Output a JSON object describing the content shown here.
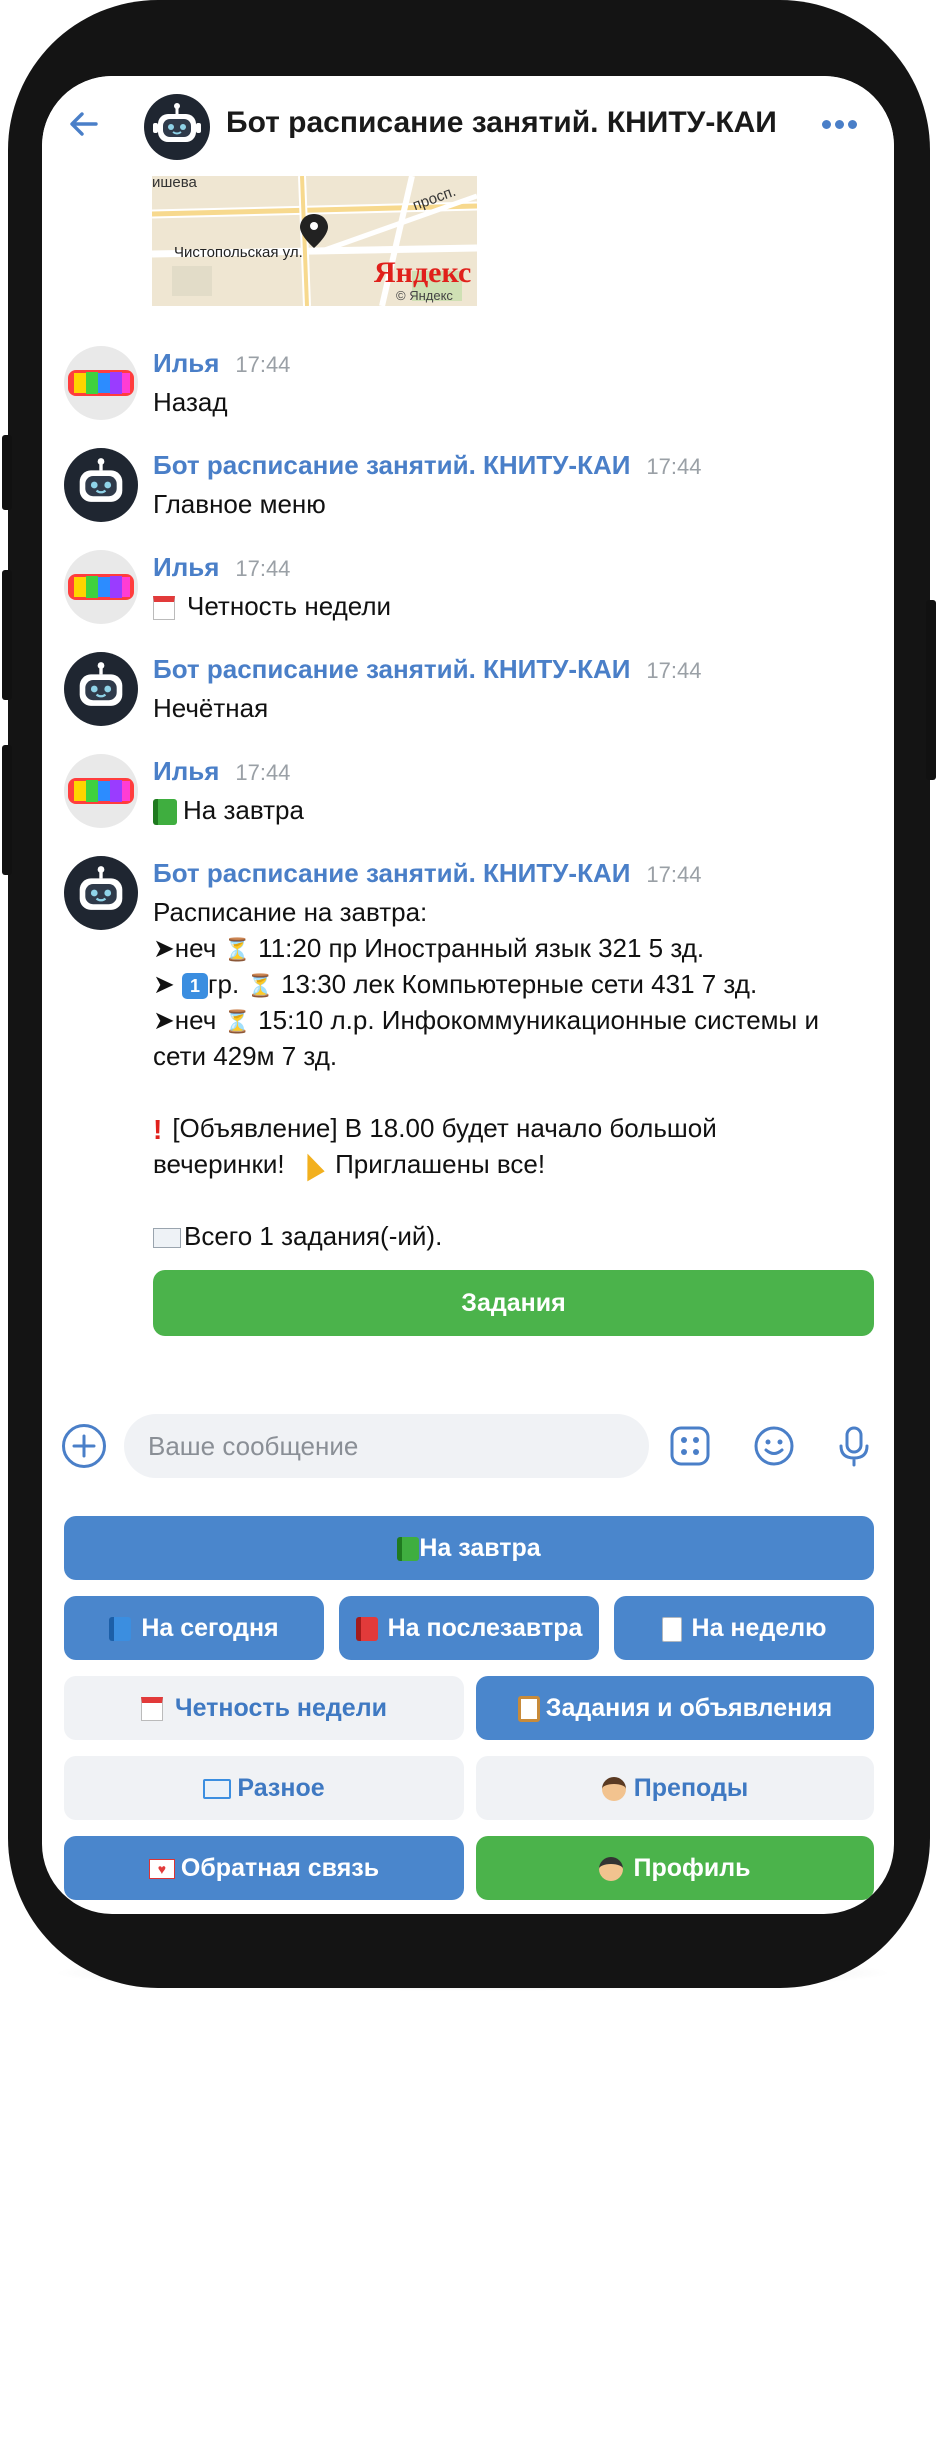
{
  "header": {
    "title": "Бот расписание занятий. КНИТУ-КАИ"
  },
  "map": {
    "labels": [
      "ишева",
      "просп.",
      "Чистопольская ул."
    ],
    "brand": "Яндекс",
    "copyright": "© Яндекс"
  },
  "messages": [
    {
      "author": "Илья",
      "time": "17:44",
      "text": "Назад"
    },
    {
      "author": "Бот расписание занятий. КНИТУ-КАИ",
      "time": "17:44",
      "text": "Главное меню"
    },
    {
      "author": "Илья",
      "time": "17:44",
      "text": "Четность недели",
      "icon": "calendar-icon"
    },
    {
      "author": "Бот расписание занятий. КНИТУ-КАИ",
      "time": "17:44",
      "text": "Нечётная"
    },
    {
      "author": "Илья",
      "time": "17:44",
      "text": "На завтра",
      "icon": "green-book-icon"
    },
    {
      "author": "Бот расписание занятий. КНИТУ-КАИ",
      "time": "17:44",
      "lines": [
        "Расписание на завтра:",
        "➤неч",
        "11:20 пр Иностранный язык 321 5 зд.",
        "➤",
        "гр.",
        "13:30 лек Компьютерные сети 431 7 зд.",
        "➤неч",
        "15:10 л.р. Инфокоммуникационные системы и",
        "сети 429м 7 зд.",
        "[Объявление] В 18.00 будет начало большой",
        "вечеринки!",
        "Приглашены все!",
        "Всего 1 задания(-ий)."
      ],
      "button": "Задания"
    }
  ],
  "composer": {
    "placeholder": "Ваше сообщение"
  },
  "keyboard": {
    "tomorrow": "На завтра",
    "today": "На сегодня",
    "day_after": "На послезавтра",
    "week": "На неделю",
    "parity": "Четность недели",
    "tasks": "Задания и объявления",
    "misc": "Разное",
    "teachers": "Преподы",
    "feedback": "Обратная связь",
    "profile": "Профиль"
  },
  "colors": {
    "accent": "#4a86cc",
    "green": "#4bb34b",
    "name": "#4a7fc8"
  }
}
